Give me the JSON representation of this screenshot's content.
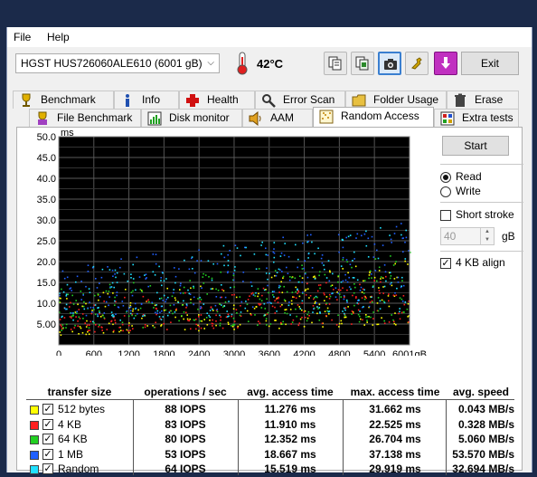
{
  "menu": {
    "file": "File",
    "help": "Help"
  },
  "toolbar": {
    "drive": "HGST HUS726060ALE610 (6001 gB)",
    "temperature": "42°C",
    "exit_label": "Exit"
  },
  "tabs_row1": [
    {
      "label": "Benchmark",
      "icon": "benchmark-icon"
    },
    {
      "label": "Info",
      "icon": "info-icon"
    },
    {
      "label": "Health",
      "icon": "health-icon"
    },
    {
      "label": "Error Scan",
      "icon": "error-scan-icon"
    },
    {
      "label": "Folder Usage",
      "icon": "folder-icon"
    },
    {
      "label": "Erase",
      "icon": "trash-icon"
    }
  ],
  "tabs_row2": [
    {
      "label": "File Benchmark",
      "icon": "file-benchmark-icon"
    },
    {
      "label": "Disk monitor",
      "icon": "disk-monitor-icon"
    },
    {
      "label": "AAM",
      "icon": "speaker-icon"
    },
    {
      "label": "Random Access",
      "icon": "random-access-icon",
      "active": true
    },
    {
      "label": "Extra tests",
      "icon": "extra-tests-icon"
    }
  ],
  "controls": {
    "start_label": "Start",
    "read_label": "Read",
    "write_label": "Write",
    "short_stroke_label": "Short stroke",
    "stroke_value": "40",
    "stroke_unit": "gB",
    "align_label": "4 KB align",
    "mode": "read",
    "short_stroke": false,
    "align_4kb": true
  },
  "chart_data": {
    "type": "scatter",
    "ylabel": "ms",
    "y_ticks": [
      "50.0",
      "45.0",
      "40.0",
      "35.0",
      "30.0",
      "25.0",
      "20.0",
      "15.0",
      "10.0",
      "5.00"
    ],
    "x_ticks": [
      "0",
      "600",
      "1200",
      "1800",
      "2400",
      "3000",
      "3600",
      "4200",
      "4800",
      "5400",
      "6001gB"
    ],
    "xlim": [
      0,
      6001
    ],
    "ylim": [
      0,
      50
    ],
    "grid": true,
    "background": "#000000",
    "series": [
      {
        "name": "512 bytes",
        "color": "#ffff00",
        "min_ms": 2.5,
        "max_ms": 20.5
      },
      {
        "name": "4 KB",
        "color": "#ff2020",
        "min_ms": 3.0,
        "max_ms": 17.0
      },
      {
        "name": "64 KB",
        "color": "#22d022",
        "min_ms": 3.5,
        "max_ms": 22.5
      },
      {
        "name": "1 MB",
        "color": "#2060ff",
        "min_ms": 7.0,
        "max_ms": 30.0
      },
      {
        "name": "Random",
        "color": "#20e0ff",
        "min_ms": 5.5,
        "max_ms": 30.0
      }
    ]
  },
  "results": {
    "headers": [
      "transfer size",
      "operations / sec",
      "avg. access time",
      "max. access time",
      "avg. speed"
    ],
    "rows": [
      {
        "size": "512 bytes",
        "color": "#ffff00",
        "iops": "88 IOPS",
        "avg": "11.276 ms",
        "max": "31.662 ms",
        "speed": "0.043 MB/s"
      },
      {
        "size": "4 KB",
        "color": "#ff2020",
        "iops": "83 IOPS",
        "avg": "11.910 ms",
        "max": "22.525 ms",
        "speed": "0.328 MB/s"
      },
      {
        "size": "64 KB",
        "color": "#22d022",
        "iops": "80 IOPS",
        "avg": "12.352 ms",
        "max": "26.704 ms",
        "speed": "5.060 MB/s"
      },
      {
        "size": "1 MB",
        "color": "#2060ff",
        "iops": "53 IOPS",
        "avg": "18.667 ms",
        "max": "37.138 ms",
        "speed": "53.570 MB/s"
      },
      {
        "size": "Random",
        "color": "#20e0ff",
        "iops": "64 IOPS",
        "avg": "15.519 ms",
        "max": "29.919 ms",
        "speed": "32.694 MB/s"
      }
    ]
  }
}
